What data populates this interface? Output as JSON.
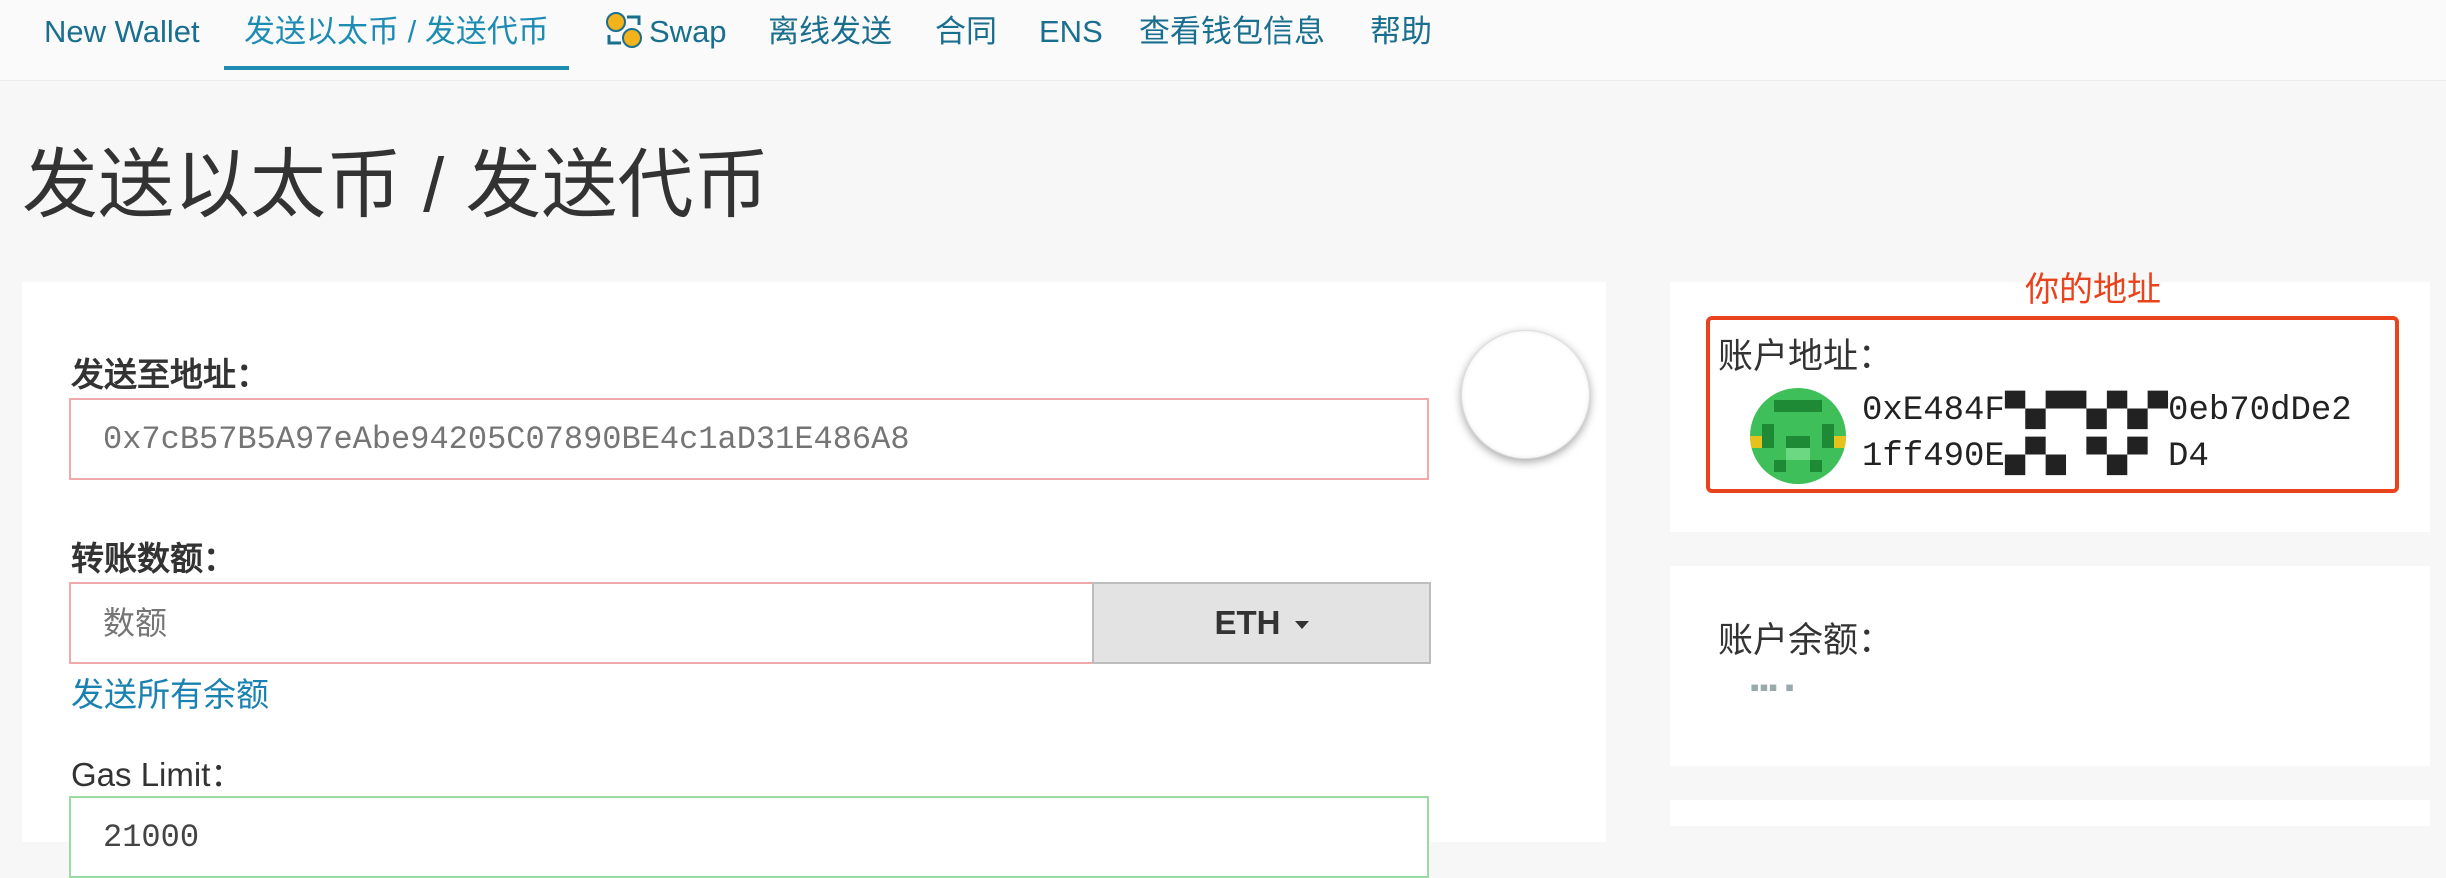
{
  "nav": {
    "new_wallet": "New Wallet",
    "send": "发送以太币 / 发送代币",
    "swap": "Swap",
    "offline": "离线发送",
    "contracts": "合同",
    "ens": "ENS",
    "view_wallet": "查看钱包信息",
    "help": "帮助"
  },
  "page_title": "发送以太币 / 发送代币",
  "form": {
    "to_label": "发送至地址：",
    "to_placeholder": "0x7cB57B5A97eAbe94205C07890BE4c1aD31E486A8",
    "amount_label": "转账数额：",
    "amount_placeholder": "数额",
    "currency": "ETH",
    "send_all": "发送所有余额",
    "gas_label": "Gas Limit：",
    "gas_value": "21000"
  },
  "account": {
    "annotation": "你的地址",
    "address_label": "账户地址：",
    "address_line1": "0xE484F▀▄▀▀▄▀▄▀0eb70dDe2",
    "address_line2": "1ff490E▄▀▄ ▀▄▀ D4",
    "balance_label": "账户余额：",
    "balance_value": "▪▪▪ ▪"
  },
  "colors": {
    "accent": "#1d8cb3",
    "link": "#1a82b0",
    "error_border": "#f2a9a9",
    "valid_border": "#9bdba3",
    "annotation": "#e8431c"
  },
  "icons": {
    "swap": "swap-icon",
    "caret": "caret-down-icon",
    "identicon": "identicon"
  }
}
